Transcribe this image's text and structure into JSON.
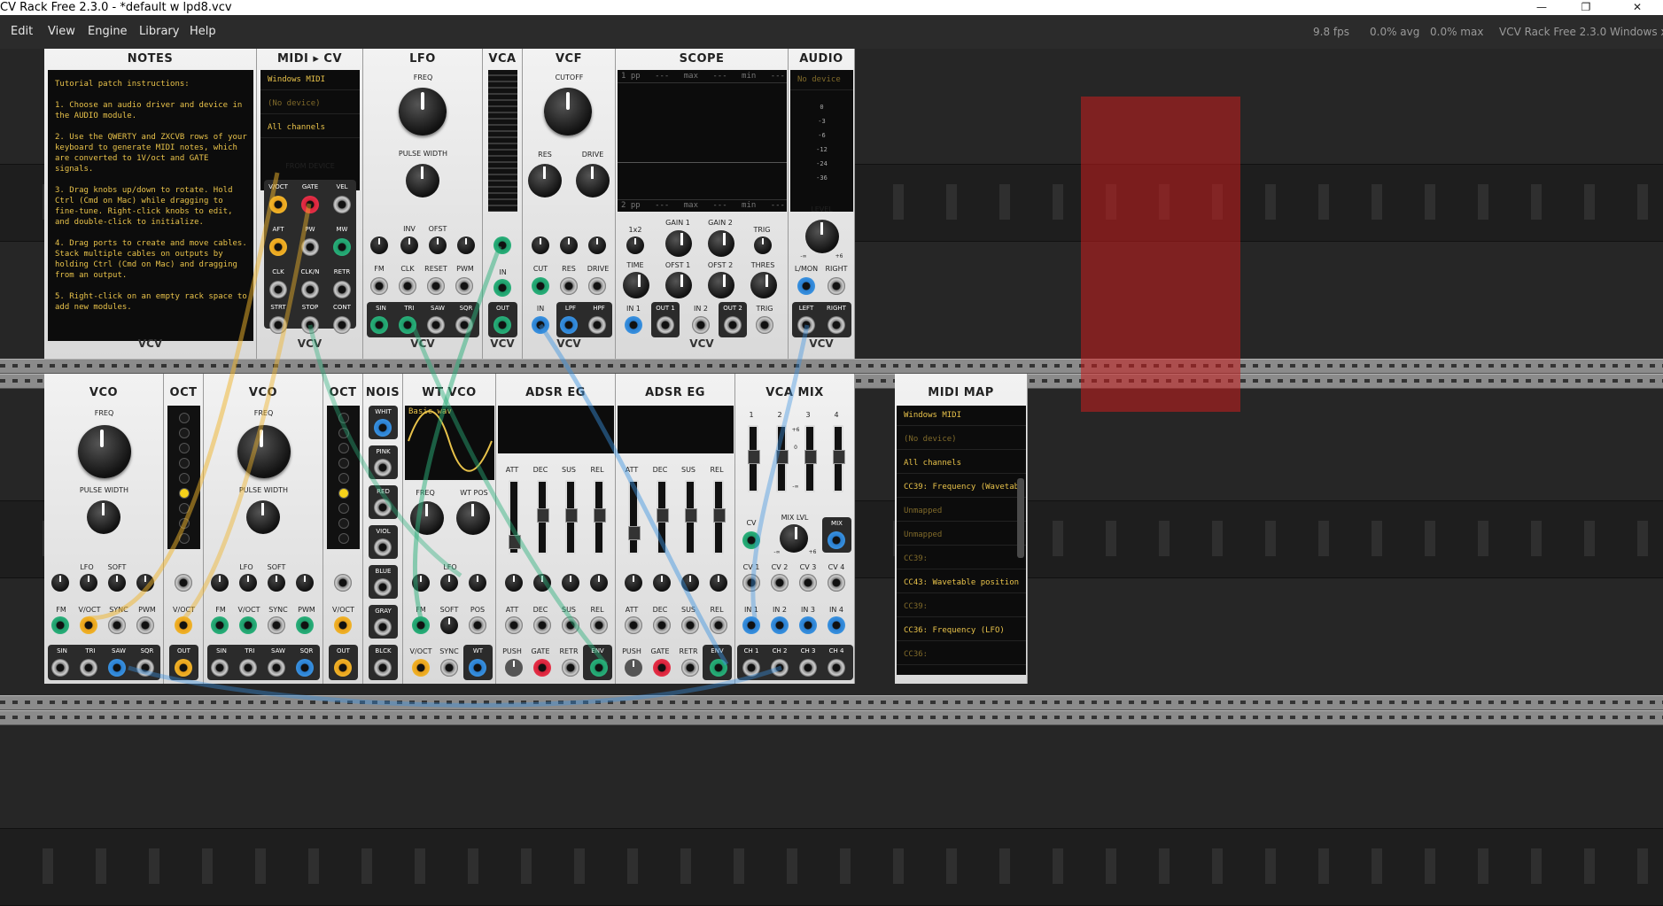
{
  "window": {
    "title": "CV Rack Free 2.3.0 - *default w lpd8.vcv",
    "buttons": {
      "minimize": "—",
      "restore": "❐",
      "close": "✕"
    }
  },
  "menu": [
    "Edit",
    "View",
    "Engine",
    "Library",
    "Help"
  ],
  "status": {
    "fps": "9.8 fps",
    "avg": "0.0% avg",
    "max": "0.0% max",
    "app": "VCV Rack Free 2.3.0 Windows x64"
  },
  "colors": {
    "selection": "#c81e1e",
    "screen_text": "#e8c24a",
    "cable_green": "#2ab07a",
    "cable_blue": "#3a92e0",
    "cable_yellow": "#f0b42a"
  },
  "brand": "VCV",
  "row1": {
    "notes": {
      "title": "NOTES",
      "text": "Tutorial patch instructions:\n\n1. Choose an audio driver and device in the AUDIO module.\n\n2. Use the QWERTY and ZXCVB rows of your keyboard to generate MIDI notes, which are converted to 1V/oct and GATE signals.\n\n3. Drag knobs up/down to rotate. Hold Ctrl (Cmd on Mac) while dragging to fine-tune. Right-click knobs to edit, and double-click to initialize.\n\n4. Drag ports to create and move cables. Stack multiple cables on outputs by holding Ctrl (Cmd on Mac) and dragging from an output.\n\n5. Right-click on an empty rack space to add new modules."
    },
    "midicv": {
      "title": "MIDI ▸ CV",
      "driver": "Windows MIDI",
      "device": "(No device)",
      "channel": "All channels",
      "section": "FROM DEVICE",
      "ports": [
        "V/OCT",
        "GATE",
        "VEL",
        "AFT",
        "PW",
        "MW",
        "CLK",
        "CLK/N",
        "RETR",
        "STRT",
        "STOP",
        "CONT"
      ]
    },
    "lfo": {
      "title": "LFO",
      "freq": "FREQ",
      "pw": "PULSE WIDTH",
      "mods": [
        "INV",
        "OFST"
      ],
      "inputs": [
        "FM",
        "CLK",
        "RESET",
        "PWM"
      ],
      "outputs": [
        "SIN",
        "TRI",
        "SAW",
        "SQR"
      ]
    },
    "vca": {
      "title": "VCA",
      "in": "IN",
      "out": "OUT"
    },
    "vcf": {
      "title": "VCF",
      "cutoff": "CUTOFF",
      "res": "RES",
      "drive": "DRIVE",
      "inputs": [
        "CUT",
        "RES",
        "DRIVE"
      ],
      "in": "IN",
      "outputs": [
        "LPF",
        "HPF"
      ]
    },
    "scope": {
      "title": "SCOPE",
      "header": [
        "1  pp",
        "---",
        "max",
        "---",
        "min",
        "---"
      ],
      "footer": [
        "2  pp",
        "---",
        "max",
        "---",
        "min",
        "---"
      ],
      "x2": "1x2",
      "gains": [
        "GAIN 1",
        "GAIN 2"
      ],
      "trig": "TRIG",
      "time": "TIME",
      "ofsts": [
        "OFST 1",
        "OFST 2"
      ],
      "thres": "THRES",
      "ports": [
        "IN 1",
        "OUT 1",
        "IN 2",
        "OUT 2",
        "TRIG"
      ]
    },
    "audio": {
      "title": "AUDIO",
      "device": "No device",
      "meter": [
        "0",
        "-3",
        "-6",
        "-12",
        "-24",
        "-36"
      ],
      "level": "LEVEL",
      "range_min": "-∞",
      "range_max": "+6",
      "inputs": [
        "L/MON",
        "RIGHT"
      ],
      "outputs": [
        "LEFT",
        "RIGHT"
      ]
    }
  },
  "row2": {
    "vco1": {
      "title": "VCO",
      "freq": "FREQ",
      "pw": "PULSE WIDTH",
      "mods": [
        "LFO",
        "SOFT"
      ],
      "inputs": [
        "FM",
        "V/OCT",
        "SYNC",
        "PWM"
      ],
      "outputs": [
        "SIN",
        "TRI",
        "SAW",
        "SQR"
      ]
    },
    "oct1": {
      "title": "OCT",
      "in": "V/OCT",
      "out": "OUT"
    },
    "vco2": {
      "title": "VCO",
      "freq": "FREQ",
      "pw": "PULSE WIDTH",
      "mods": [
        "LFO",
        "SOFT"
      ],
      "inputs": [
        "FM",
        "V/OCT",
        "SYNC",
        "PWM"
      ],
      "outputs": [
        "SIN",
        "TRI",
        "SAW",
        "SQR"
      ]
    },
    "oct2": {
      "title": "OCT",
      "in": "V/OCT",
      "out": "OUT"
    },
    "noise": {
      "title": "NOIS",
      "outputs": [
        "WHIT",
        "PINK",
        "RED",
        "VIOL",
        "BLUE",
        "GRAY",
        "BLCK"
      ]
    },
    "wtvco": {
      "title": "WT VCO",
      "wave": "Basic.wav",
      "freq": "FREQ",
      "wtpos": "WT POS",
      "mods": [
        "LFO"
      ],
      "inputs": [
        "FM",
        "SOFT",
        "POS"
      ],
      "ports": [
        "V/OCT",
        "SYNC",
        "WT"
      ]
    },
    "adsr1": {
      "title": "ADSR EG",
      "params": [
        "ATT",
        "DEC",
        "SUS",
        "REL"
      ],
      "ports": [
        "PUSH",
        "GATE",
        "RETR",
        "ENV"
      ]
    },
    "adsr2": {
      "title": "ADSR EG",
      "params": [
        "ATT",
        "DEC",
        "SUS",
        "REL"
      ],
      "ports": [
        "PUSH",
        "GATE",
        "RETR",
        "ENV"
      ]
    },
    "vcamix": {
      "title": "VCA MIX",
      "channels": [
        "1",
        "2",
        "3",
        "4"
      ],
      "scale": [
        "+6",
        "0",
        "-∞"
      ],
      "cv": "CV",
      "mixlvl": "MIX LVL",
      "mix": "MIX",
      "range_min": "-∞",
      "range_max": "+6",
      "cvs": [
        "CV 1",
        "CV 2",
        "CV 3",
        "CV 4"
      ],
      "ins": [
        "IN 1",
        "IN 2",
        "IN 3",
        "IN 4"
      ],
      "outs": [
        "CH 1",
        "CH 2",
        "CH 3",
        "CH 4"
      ]
    },
    "midimap": {
      "title": "MIDI MAP",
      "rows": [
        {
          "text": "Windows MIDI",
          "dim": false
        },
        {
          "text": "(No device)",
          "dim": true
        },
        {
          "text": "All channels",
          "dim": false
        },
        {
          "text": "CC39: Frequency (Wavetab",
          "dim": false
        },
        {
          "text": "Unmapped",
          "dim": true
        },
        {
          "text": "Unmapped",
          "dim": true
        },
        {
          "text": "CC39:",
          "dim": true
        },
        {
          "text": "CC43: Wavetable position",
          "dim": false
        },
        {
          "text": "CC39:",
          "dim": true
        },
        {
          "text": "CC36: Frequency (LFO)",
          "dim": false
        },
        {
          "text": "CC36:",
          "dim": true
        }
      ]
    }
  }
}
